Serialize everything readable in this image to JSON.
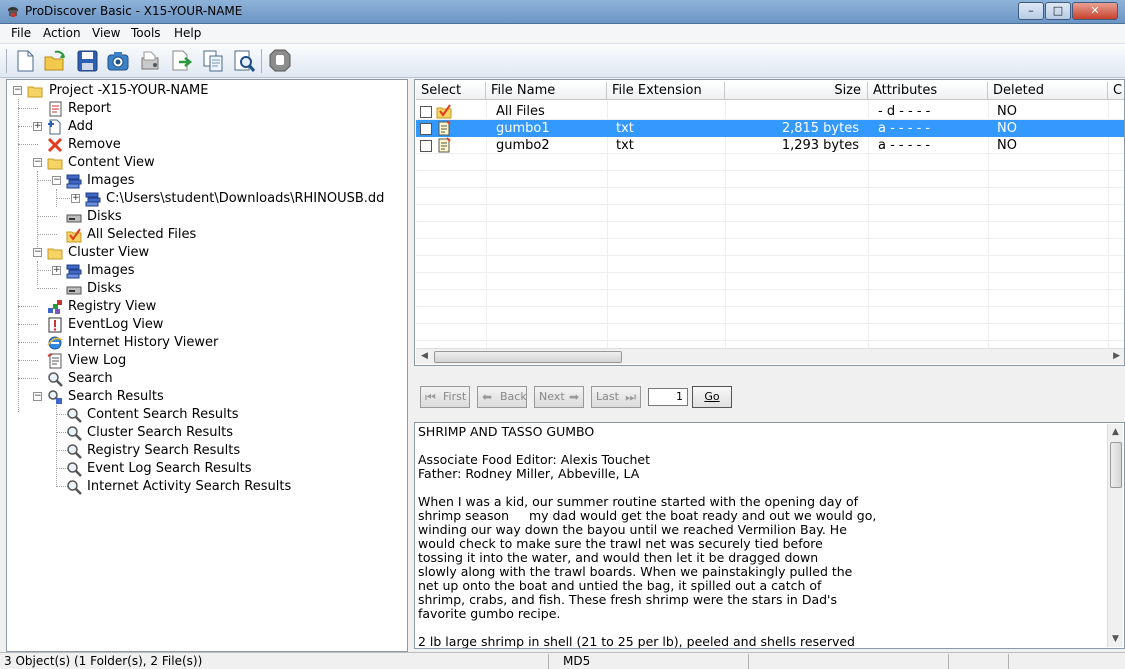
{
  "window": {
    "title": "ProDiscover Basic - X15-YOUR-NAME",
    "controls": {
      "minimize": "–",
      "maximize": "□",
      "close": "✕"
    }
  },
  "menu": [
    "File",
    "Action",
    "View",
    "Tools",
    "Help"
  ],
  "toolbar": {
    "icons": [
      "new-project-icon",
      "open-project-icon",
      "save-icon",
      "capture-image-icon",
      "add-disk-icon",
      "export-icon",
      "copy-icon",
      "search-icon",
      "stop-icon"
    ]
  },
  "tree": {
    "root": "Project -X15-YOUR-NAME",
    "report": "Report",
    "add": "Add",
    "remove": "Remove",
    "content_view": "Content View",
    "images": "Images",
    "image_path": "C:\\Users\\student\\Downloads\\RHINOUSB.dd",
    "disks": "Disks",
    "all_selected_files": "All Selected Files",
    "cluster_view": "Cluster View",
    "cluster_images": "Images",
    "cluster_disks": "Disks",
    "registry_view": "Registry View",
    "eventlog_view": "EventLog View",
    "internet_history_viewer": "Internet History Viewer",
    "view_log": "View Log",
    "search": "Search",
    "search_results": "Search Results",
    "content_search_results": "Content Search Results",
    "cluster_search_results": "Cluster Search Results",
    "registry_search_results": "Registry Search Results",
    "event_log_search_results": "Event Log Search Results",
    "internet_activity_search_results": "Internet Activity Search Results"
  },
  "file_list": {
    "columns": [
      "Select",
      "File Name",
      "File Extension",
      "Size",
      "Attributes",
      "Deleted",
      "C"
    ],
    "rows": [
      {
        "name": "All Files",
        "ext": "",
        "size": "",
        "attributes": "- d - - - -",
        "deleted": "NO",
        "selected": false
      },
      {
        "name": "gumbo1",
        "ext": "txt",
        "size": "2,815 bytes",
        "attributes": "a - - - - -",
        "deleted": "NO",
        "selected": true
      },
      {
        "name": "gumbo2",
        "ext": "txt",
        "size": "1,293 bytes",
        "attributes": "a - - - - -",
        "deleted": "NO",
        "selected": false
      }
    ]
  },
  "navigation": {
    "first": "First",
    "back": "Back",
    "next": "Next",
    "last": "Last",
    "page": "1",
    "go": "Go"
  },
  "viewer": {
    "text": "SHRIMP AND TASSO GUMBO\n\nAssociate Food Editor: Alexis Touchet\nFather: Rodney Miller, Abbeville, LA\n\nWhen I was a kid, our summer routine started with the opening day of\nshrimp season     my dad would get the boat ready and out we would go,\nwinding our way down the bayou until we reached Vermilion Bay. He\nwould check to make sure the trawl net was securely tied before\ntossing it into the water, and would then let it be dragged down\nslowly along with the trawl boards. When we painstakingly pulled the\nnet up onto the boat and untied the bag, it spilled out a catch of\nshrimp, crabs, and fish. These fresh shrimp were the stars in Dad's\nfavorite gumbo recipe.\n\n2 lb large shrimp in shell (21 to 25 per lb), peeled and shells reserved"
  },
  "status": {
    "objects": "3 Object(s) (1 Folder(s), 2 File(s))",
    "hash": "MD5"
  }
}
